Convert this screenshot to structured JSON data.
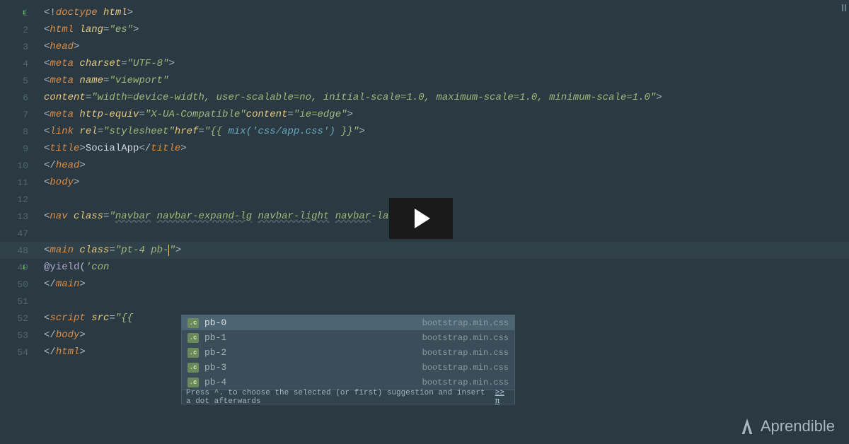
{
  "gutter": {
    "lines": [
      "1",
      "2",
      "3",
      "4",
      "5",
      "6",
      "7",
      "8",
      "9",
      "10",
      "11",
      "12",
      "13",
      "47",
      "48",
      "49",
      "50",
      "51",
      "52",
      "53",
      "54"
    ],
    "highlighted": "48",
    "vcs_markers": [
      "1",
      "49"
    ]
  },
  "code": {
    "l1": {
      "open": "<!",
      "tag": "doctype ",
      "attr": "html",
      "close": ">"
    },
    "l2": {
      "open": "<",
      "tag": "html ",
      "attr": "lang",
      "eq": "=",
      "val": "\"es\"",
      "close": ">"
    },
    "l3": {
      "open": "<",
      "tag": "head",
      "close": ">"
    },
    "l4": {
      "open": "<",
      "tag": "meta ",
      "attr": "charset",
      "eq": "=",
      "val": "\"UTF-8\"",
      "close": ">"
    },
    "l5": {
      "open": "<",
      "tag": "meta ",
      "attr": "name",
      "eq": "=",
      "val": "\"viewport\""
    },
    "l6": {
      "attr": "content",
      "eq": "=",
      "val": "\"width=device-width, user-scalable=no, initial-scale=1.0, maximum-scale=1.0, minimum-scale=1.0\"",
      "close": ">"
    },
    "l7": {
      "open": "<",
      "tag": "meta ",
      "attr1": "http-equiv",
      "val1": "\"X-UA-Compatible\"",
      "attr2": "content",
      "val2": "\"ie=edge\"",
      "close": ">"
    },
    "l8": {
      "open": "<",
      "tag": "link ",
      "attr1": "rel",
      "val1": "\"stylesheet\"",
      "attr2": "href",
      "val2a": "\"{{ ",
      "val2b": "mix('css/app.css')",
      "val2c": " }}\"",
      "close": ">"
    },
    "l9": {
      "open": "<",
      "tag": "title",
      "close": ">",
      "text": "SocialApp",
      "open2": "</",
      "tag2": "title",
      "close2": ">"
    },
    "l10": {
      "open": "</",
      "tag": "head",
      "close": ">"
    },
    "l11": {
      "open": "<",
      "tag": "body",
      "close": ">"
    },
    "l13": {
      "open": "<",
      "tag": "nav ",
      "attr": "class",
      "eq": "=",
      "q": "\"",
      "c1": "navbar",
      "sp": " ",
      "c2": "navbar-expand-lg",
      "c3": "navbar-light",
      "c4": "navbar",
      "c4a": "-laravel",
      "q2": "\"",
      "dots": "...",
      "close": ">"
    },
    "l48": {
      "open": "<",
      "tag": "main ",
      "attr": "class",
      "eq": "=",
      "val": "\"pt-4 pb-",
      "close": "\">"
    },
    "l49": {
      "blade": "@yield",
      "paren": "(",
      "str": "'con",
      "rest": ""
    },
    "l50": {
      "open": "</",
      "tag": "main",
      "close": ">"
    },
    "l52": {
      "open": "<",
      "tag": "script ",
      "attr": "src",
      "eq": "=",
      "val": "\"{{"
    },
    "l53": {
      "open": "</",
      "tag": "body",
      "close": ">"
    },
    "l54": {
      "open": "</",
      "tag": "html",
      "close": ">"
    }
  },
  "autocomplete": {
    "items": [
      {
        "label": "pb-0",
        "src": "bootstrap.min.css"
      },
      {
        "label": "pb-1",
        "src": "bootstrap.min.css"
      },
      {
        "label": "pb-2",
        "src": "bootstrap.min.css"
      },
      {
        "label": "pb-3",
        "src": "bootstrap.min.css"
      },
      {
        "label": "pb-4",
        "src": "bootstrap.min.css"
      }
    ],
    "icon_text": ".c",
    "hint": "Press ^. to choose the selected (or first) suggestion and insert a dot afterwards",
    "hint_link": "≥≥ π"
  },
  "watermark": {
    "text": "Aprendible"
  }
}
